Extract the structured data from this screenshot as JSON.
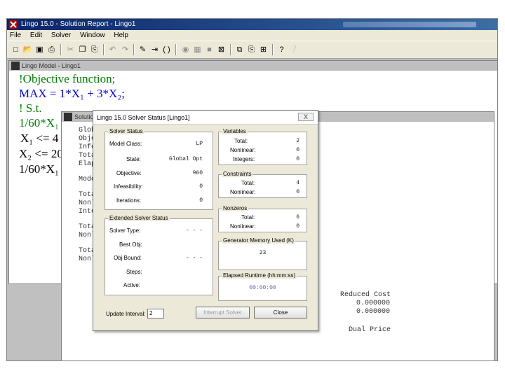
{
  "app": {
    "title": "Lingo 15.0 - Solution Report - Lingo1",
    "menu": [
      "File",
      "Edit",
      "Solver",
      "Window",
      "Help"
    ]
  },
  "model_window": {
    "title": "Lingo Model - Lingo1",
    "lines": [
      {
        "text": "!Objective function;",
        "color": "green"
      },
      {
        "text": "MAX = 1*X₁ + 3*X₂;",
        "color": "blue"
      },
      {
        "text": "! S.t.",
        "color": "green"
      },
      {
        "text": "1/60*X₁",
        "color": "green"
      },
      {
        "text": "X₁ <= 4",
        "color": "black"
      },
      {
        "text": "X₂ <= 20",
        "color": "black"
      },
      {
        "text": "1/60*X₁",
        "color": "black"
      }
    ]
  },
  "report_window": {
    "title": "Solution Report - Lingo1",
    "left_labels": [
      "Glob",
      "Obje",
      "Infe",
      "Tota",
      "Elap",
      "Mode",
      "Tota",
      "Nonl",
      "Inte",
      "Tota",
      "Nonl",
      "Tota",
      "Nonl"
    ],
    "reduced_cost_header": "Reduced Cost",
    "reduced_costs": [
      "0.000000",
      "0.000000"
    ],
    "dual_price_header": "Dual Price"
  },
  "dialog": {
    "title": "Lingo 15.0 Solver Status [Lingo1]",
    "close_label": "X",
    "solver_status": {
      "label": "Solver Status",
      "model_class_label": "Model Class:",
      "model_class": "LP",
      "state_label": "State:",
      "state": "Global Opt",
      "objective_label": "Objective:",
      "objective": "960",
      "infeasibility_label": "Infeasibility:",
      "infeasibility": "0",
      "iterations_label": "Iterations:",
      "iterations": "0"
    },
    "extended": {
      "label": "Extended Solver Status",
      "solver_type_label": "Solver Type:",
      "solver_type": "- - -",
      "best_obj_label": "Best Obj:",
      "best_obj": "",
      "obj_bound_label": "Obj Bound:",
      "obj_bound": "- - -",
      "steps_label": "Steps:",
      "steps": "",
      "active_label": "Active:",
      "active": ""
    },
    "variables": {
      "label": "Variables",
      "total_label": "Total:",
      "total": "2",
      "nonlinear_label": "Nonlinear:",
      "nonlinear": "0",
      "integers_label": "Integers:",
      "integers": "0"
    },
    "constraints": {
      "label": "Constraints",
      "total_label": "Total:",
      "total": "4",
      "nonlinear_label": "Nonlinear:",
      "nonlinear": "0"
    },
    "nonzeros": {
      "label": "Nonzeros",
      "total_label": "Total:",
      "total": "6",
      "nonlinear_label": "Nonlinear:",
      "nonlinear": "0"
    },
    "memory": {
      "label": "Generator Memory Used (K)",
      "value": "23"
    },
    "runtime": {
      "label": "Elapsed Runtime (hh:mm:ss)",
      "value": "00:00:00"
    },
    "update_interval_label": "Update Interval:",
    "update_interval": "2",
    "interrupt_label": "Interrupt Solver",
    "close_button_label": "Close"
  }
}
